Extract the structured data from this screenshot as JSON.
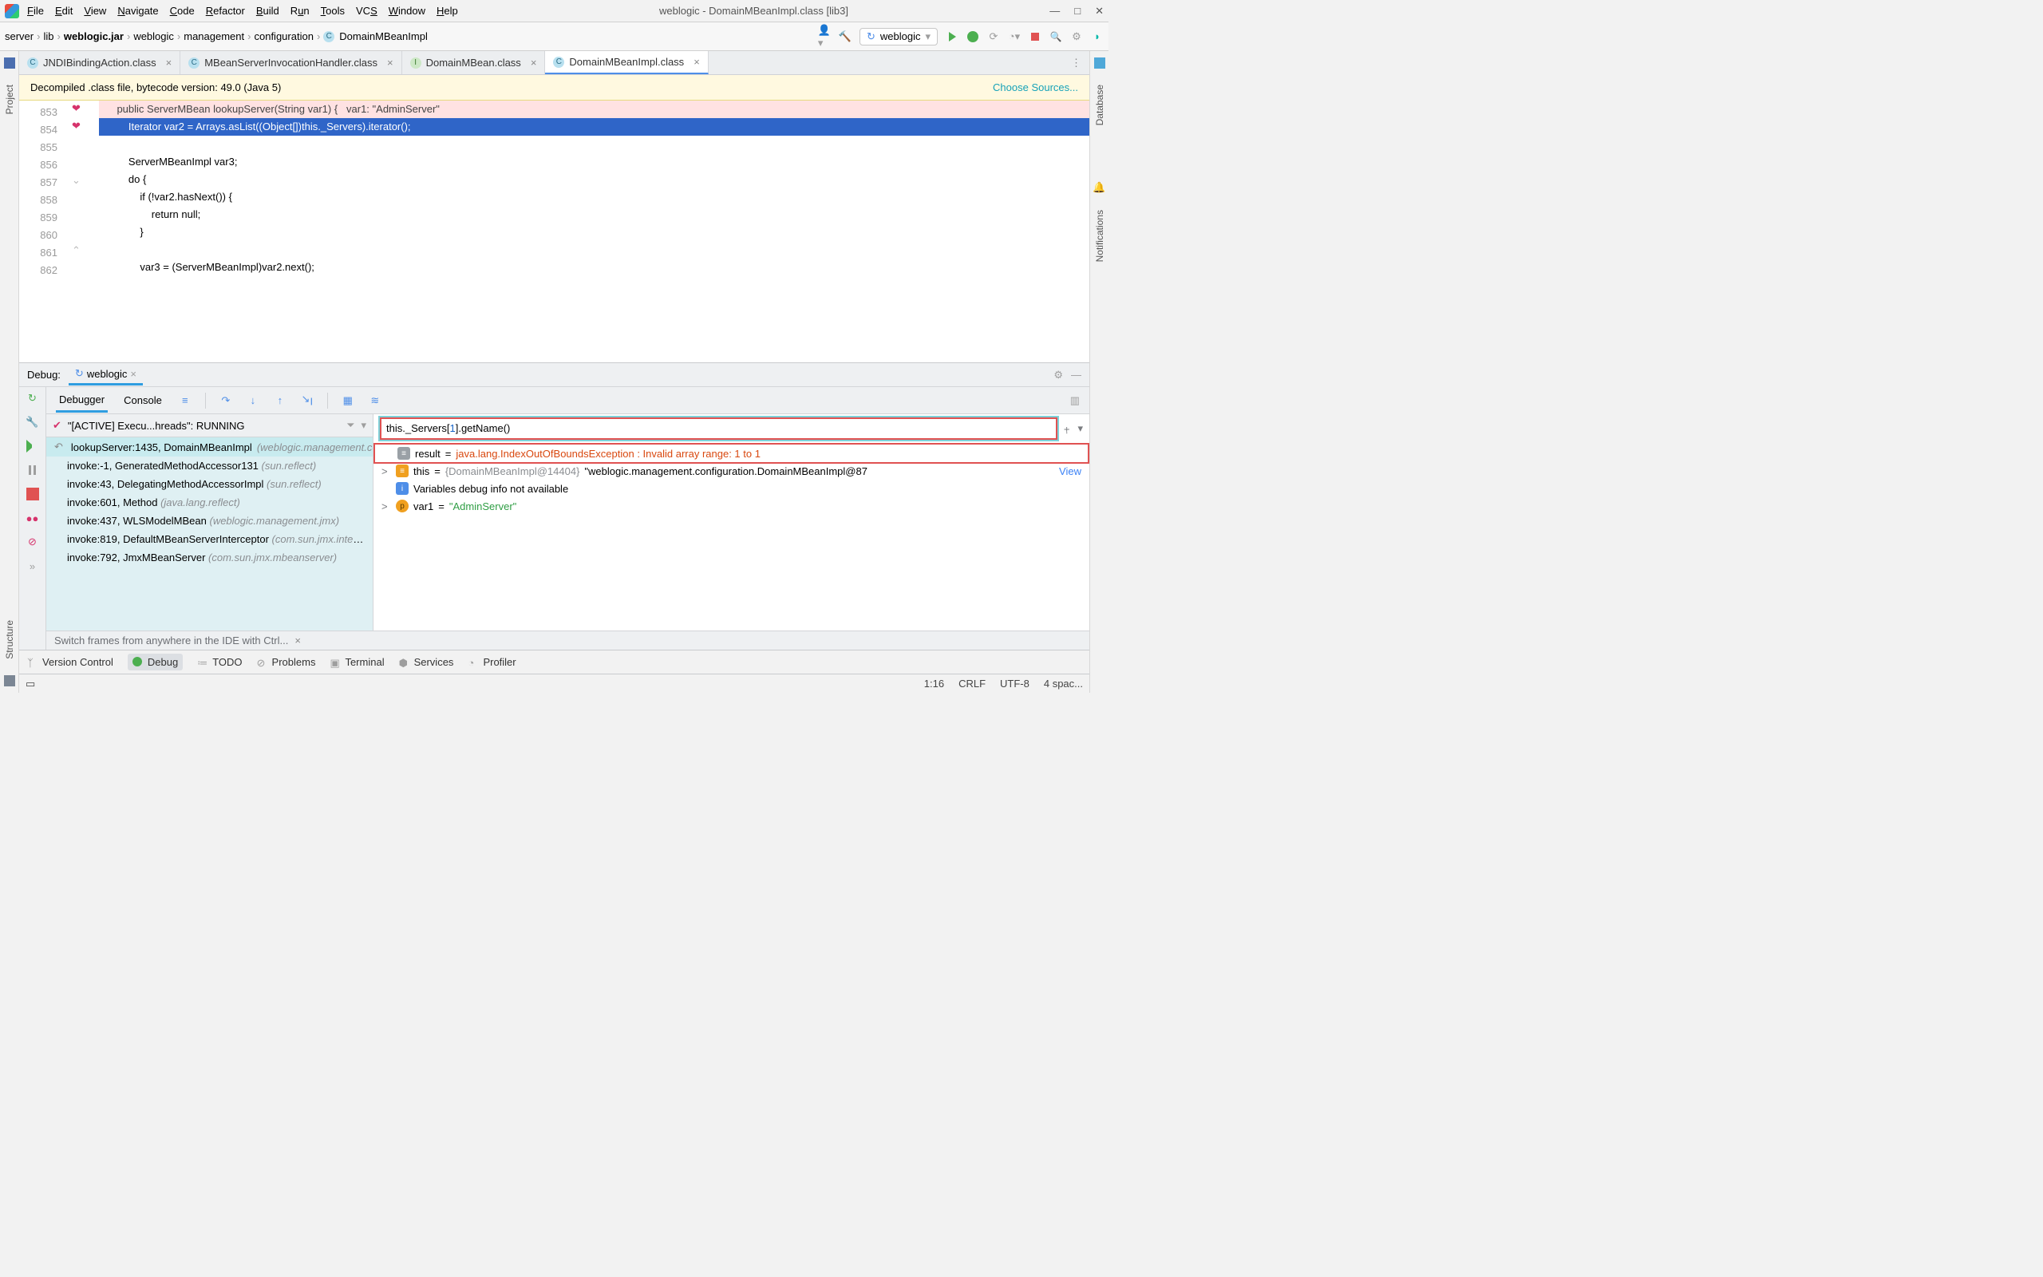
{
  "title": "weblogic - DomainMBeanImpl.class [lib3]",
  "menus": [
    "File",
    "Edit",
    "View",
    "Navigate",
    "Code",
    "Refactor",
    "Build",
    "Run",
    "Tools",
    "VCS",
    "Window",
    "Help"
  ],
  "breadcrumb": [
    "server",
    "lib",
    "weblogic.jar",
    "weblogic",
    "management",
    "configuration",
    "DomainMBeanImpl"
  ],
  "run_config": "weblogic",
  "side_left": {
    "project": "Project",
    "structure": "Structure"
  },
  "side_right": {
    "database": "Database",
    "notifications": "Notifications"
  },
  "tabs": [
    {
      "label": "JNDIBindingAction.class",
      "icon": "C",
      "active": false
    },
    {
      "label": "MBeanServerInvocationHandler.class",
      "icon": "C",
      "active": false
    },
    {
      "label": "DomainMBean.class",
      "icon": "I",
      "active": false
    },
    {
      "label": "DomainMBeanImpl.class",
      "icon": "C",
      "active": true
    }
  ],
  "banner": {
    "text": "Decompiled .class file, bytecode version: 49.0 (Java 5)",
    "link": "Choose Sources..."
  },
  "code": {
    "lines": [
      854,
      855,
      856,
      857,
      858,
      859,
      860,
      861,
      862
    ],
    "rows": [
      {
        "n": 853,
        "cut": true,
        "text": "    public ServerMBean lookupServer(String var1) {   var1: \"AdminServer\""
      },
      {
        "n": 854,
        "hl": true,
        "text": "        Iterator var2 = Arrays.asList((Object[])this._Servers).iterator();"
      },
      {
        "n": 855,
        "text": ""
      },
      {
        "n": 856,
        "text": "        ServerMBeanImpl var3;"
      },
      {
        "n": 857,
        "text": "        do {"
      },
      {
        "n": 858,
        "text": "            if (!var2.hasNext()) {"
      },
      {
        "n": 859,
        "text": "                return null;"
      },
      {
        "n": 860,
        "text": "            }"
      },
      {
        "n": 861,
        "text": ""
      },
      {
        "n": 862,
        "text": "            var3 = (ServerMBeanImpl)var2.next();"
      }
    ]
  },
  "debug": {
    "label": "Debug:",
    "run_tab": "weblogic",
    "subtabs": {
      "debugger": "Debugger",
      "console": "Console"
    },
    "thread_label": "\"[ACTIVE] Execu...hreads\": RUNNING",
    "frames": [
      {
        "top": true,
        "text": "lookupServer:1435, DomainMBeanImpl",
        "pkg": "(weblogic.management.configuration)"
      },
      {
        "text": "invoke:-1, GeneratedMethodAccessor131",
        "pkg": "(sun.reflect)"
      },
      {
        "text": "invoke:43, DelegatingMethodAccessorImpl",
        "pkg": "(sun.reflect)"
      },
      {
        "text": "invoke:601, Method",
        "pkg": "(java.lang.reflect)"
      },
      {
        "text": "invoke:437, WLSModelMBean",
        "pkg": "(weblogic.management.jmx)"
      },
      {
        "text": "invoke:819, DefaultMBeanServerInterceptor",
        "pkg": "(com.sun.jmx.interceptor)"
      },
      {
        "text": "invoke:792, JmxMBeanServer",
        "pkg": "(com.sun.jmx.mbeanserver)"
      }
    ],
    "eval_expr": {
      "pre": "this._Servers[",
      "idx": "1",
      "post": "].getName()"
    },
    "vars": [
      {
        "kind": "result",
        "name": "result",
        "eq": " = ",
        "err": "java.lang.IndexOutOfBoundsException : Invalid array range: 1 to 1"
      },
      {
        "kind": "this",
        "name": "this",
        "eq": " = ",
        "type": "{DomainMBeanImpl@14404}",
        "val": " \"weblogic.management.configuration.DomainMBeanImpl@87",
        "view": "View"
      },
      {
        "kind": "info",
        "text": "Variables debug info not available"
      },
      {
        "kind": "p",
        "name": "var1",
        "eq": " = ",
        "str": "\"AdminServer\""
      }
    ],
    "tip": "Switch frames from anywhere in the IDE with Ctrl..."
  },
  "bottom_tools": [
    "Version Control",
    "Debug",
    "TODO",
    "Problems",
    "Terminal",
    "Services",
    "Profiler"
  ],
  "status": {
    "pos": "1:16",
    "eol": "CRLF",
    "enc": "UTF-8",
    "indent": "4 spac..."
  }
}
